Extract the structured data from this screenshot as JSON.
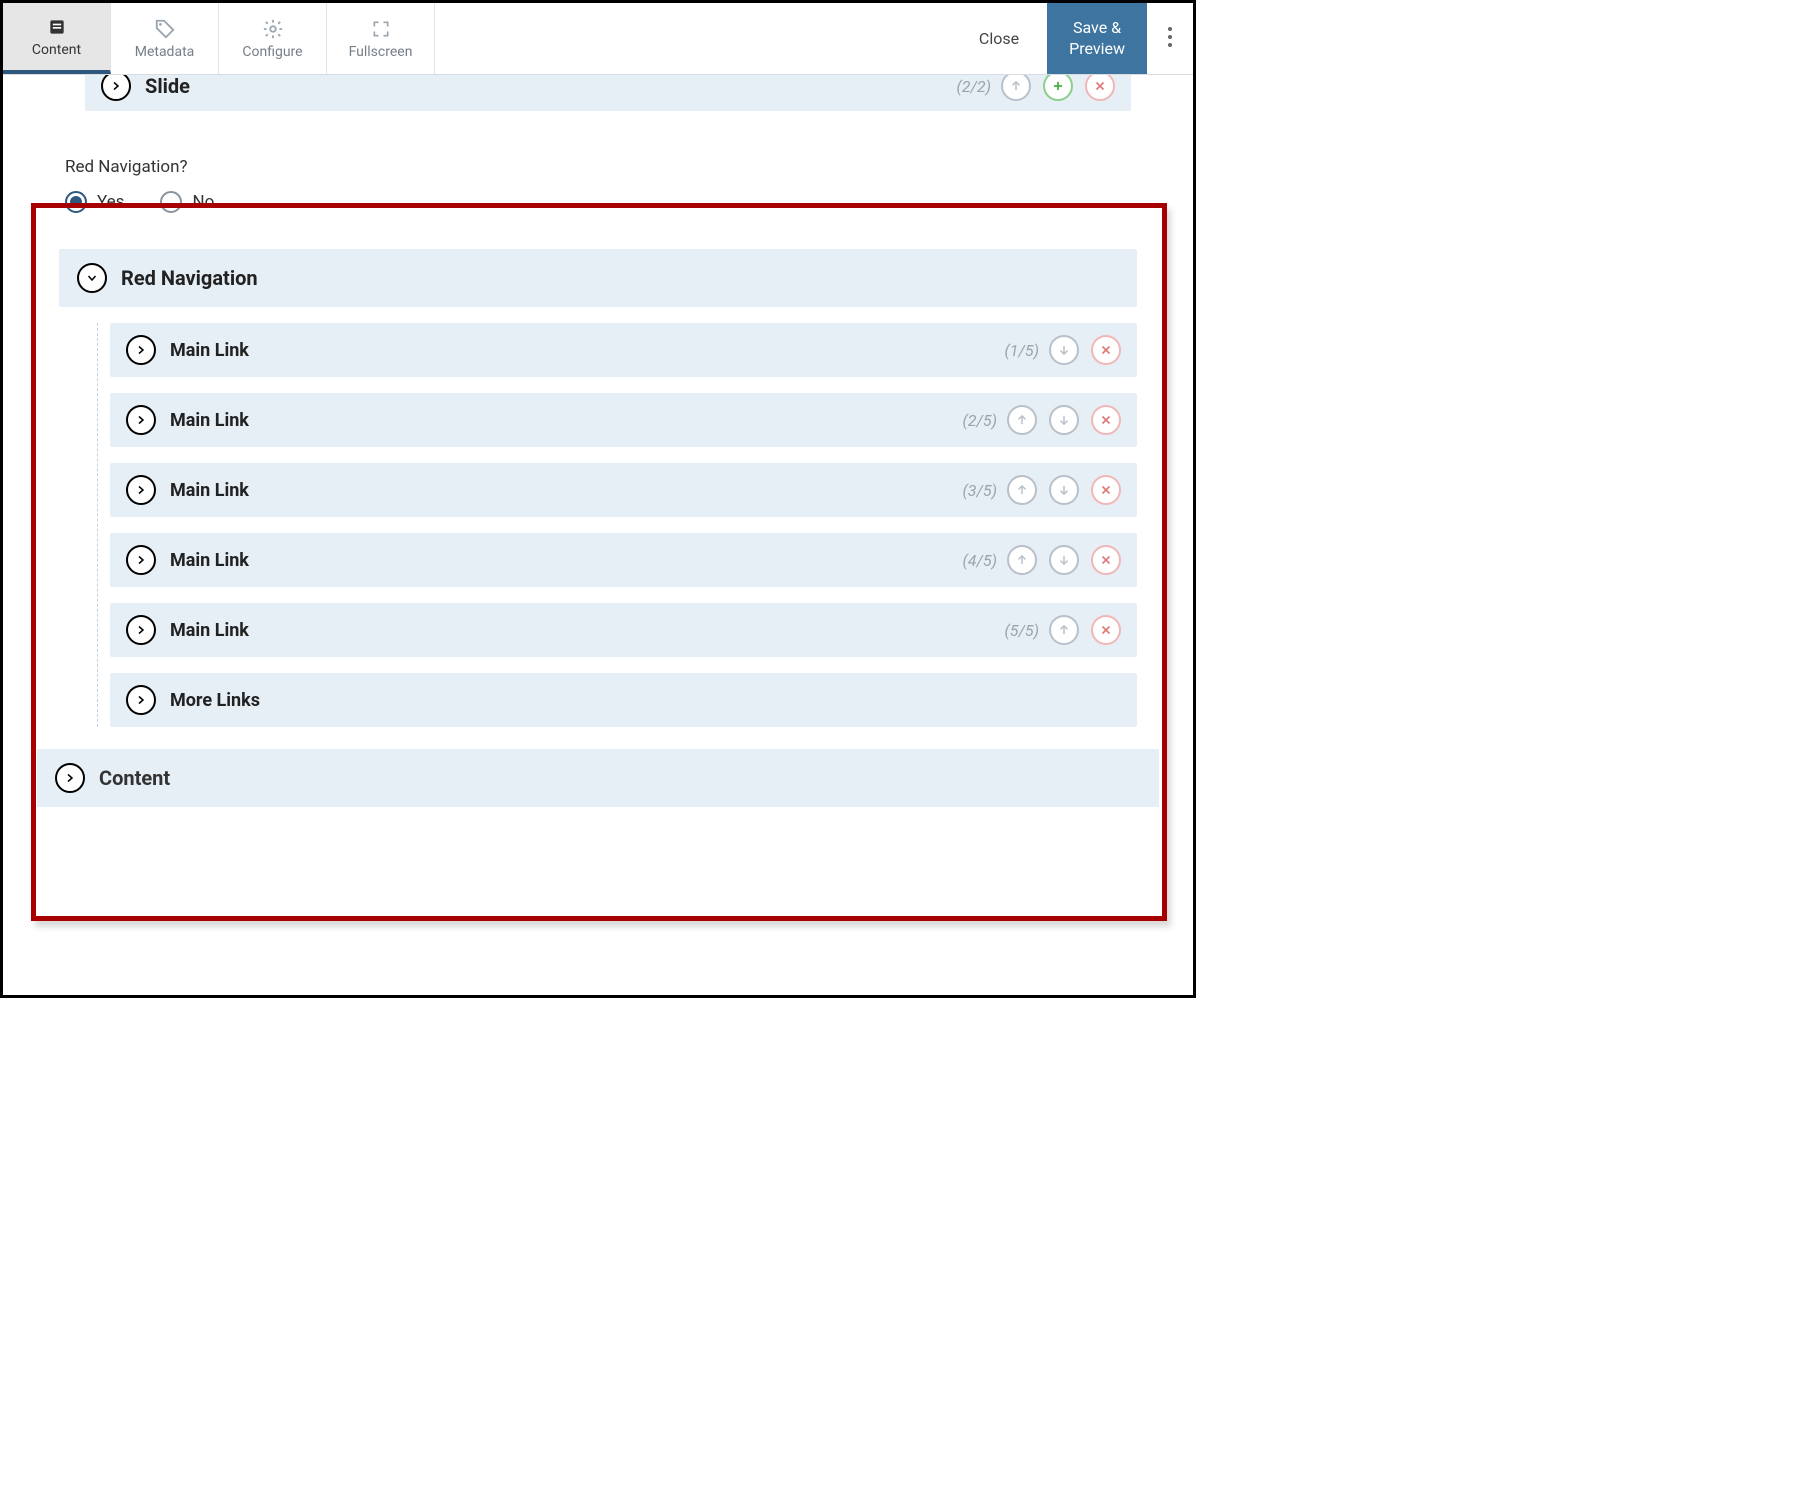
{
  "toolbar": {
    "tabs": {
      "content": "Content",
      "metadata": "Metadata",
      "configure": "Configure",
      "fullscreen": "Fullscreen"
    },
    "close": "Close",
    "save": "Save &\nPreview"
  },
  "slide": {
    "title": "Slide",
    "count": "(2/2)"
  },
  "question": {
    "label": "Red Navigation?",
    "yes": "Yes",
    "no": "No"
  },
  "section": {
    "title": "Red Navigation"
  },
  "links": [
    {
      "title": "Main Link",
      "count": "(1/5)",
      "up": false,
      "down": true
    },
    {
      "title": "Main Link",
      "count": "(2/5)",
      "up": true,
      "down": true
    },
    {
      "title": "Main Link",
      "count": "(3/5)",
      "up": true,
      "down": true
    },
    {
      "title": "Main Link",
      "count": "(4/5)",
      "up": true,
      "down": true
    },
    {
      "title": "Main Link",
      "count": "(5/5)",
      "up": true,
      "down": false
    }
  ],
  "more_links": {
    "title": "More Links"
  },
  "content_row": {
    "title": "Content"
  }
}
